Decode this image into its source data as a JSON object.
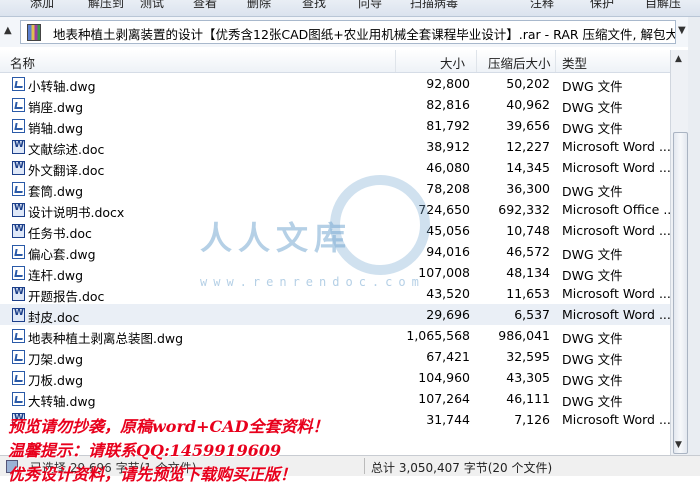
{
  "toolbar": {
    "buttons": [
      "添加",
      "解压到",
      "测试",
      "查看",
      "删除",
      "查找",
      "向导",
      "扫描病毒",
      "注释",
      "保护",
      "自解压"
    ]
  },
  "pathbar": {
    "path": "地表种植土剥离装置的设计【优秀含12张CAD图纸+农业用机械全套课程毕业设计】.rar - RAR 压缩文件, 解包大小为"
  },
  "columns": {
    "name": "名称",
    "size": "大小",
    "packed": "压缩后大小",
    "type": "类型"
  },
  "files": [
    {
      "name": "小转轴.dwg",
      "size": "92,800",
      "packed": "50,202",
      "type": "DWG 文件",
      "kind": "dwg"
    },
    {
      "name": "销座.dwg",
      "size": "82,816",
      "packed": "40,962",
      "type": "DWG 文件",
      "kind": "dwg"
    },
    {
      "name": "销轴.dwg",
      "size": "81,792",
      "packed": "39,656",
      "type": "DWG 文件",
      "kind": "dwg"
    },
    {
      "name": "文献综述.doc",
      "size": "38,912",
      "packed": "12,227",
      "type": "Microsoft Word ...",
      "kind": "doc"
    },
    {
      "name": "外文翻译.doc",
      "size": "46,080",
      "packed": "14,345",
      "type": "Microsoft Word ...",
      "kind": "doc"
    },
    {
      "name": "套筒.dwg",
      "size": "78,208",
      "packed": "36,300",
      "type": "DWG 文件",
      "kind": "dwg"
    },
    {
      "name": "设计说明书.docx",
      "size": "724,650",
      "packed": "692,332",
      "type": "Microsoft Office ...",
      "kind": "doc"
    },
    {
      "name": "任务书.doc",
      "size": "45,056",
      "packed": "10,748",
      "type": "Microsoft Word ...",
      "kind": "doc"
    },
    {
      "name": "偏心套.dwg",
      "size": "94,016",
      "packed": "46,572",
      "type": "DWG 文件",
      "kind": "dwg"
    },
    {
      "name": "连杆.dwg",
      "size": "107,008",
      "packed": "48,134",
      "type": "DWG 文件",
      "kind": "dwg"
    },
    {
      "name": "开题报告.doc",
      "size": "43,520",
      "packed": "11,653",
      "type": "Microsoft Word ...",
      "kind": "doc"
    },
    {
      "name": "封皮.doc",
      "size": "29,696",
      "packed": "6,537",
      "type": "Microsoft Word ...",
      "kind": "doc",
      "selected": true
    },
    {
      "name": "地表种植土剥离总装图.dwg",
      "size": "1,065,568",
      "packed": "986,041",
      "type": "DWG 文件",
      "kind": "dwg"
    },
    {
      "name": "刀架.dwg",
      "size": "67,421",
      "packed": "32,595",
      "type": "DWG 文件",
      "kind": "dwg"
    },
    {
      "name": "刀板.dwg",
      "size": "104,960",
      "packed": "43,305",
      "type": "DWG 文件",
      "kind": "dwg"
    },
    {
      "name": "大转轴.dwg",
      "size": "107,264",
      "packed": "46,111",
      "type": "DWG 文件",
      "kind": "dwg"
    },
    {
      "name": "",
      "size": "31,744",
      "packed": "7,126",
      "type": "Microsoft Word ...",
      "kind": "doc"
    }
  ],
  "status": {
    "left": "已选择 29,696 字节(1 个文件)",
    "right": "总计 3,050,407 字节(20 个文件)"
  },
  "watermark": {
    "chars": "人人文库",
    "url": "www.renrendoc.com"
  },
  "overlay": {
    "line1": "预览请勿抄袭，原稿word+CAD全套资料！",
    "line2": "温馨提示：请联系QQ:1459919609",
    "line3": "优秀设计资料，请先预览下载购买正版！"
  },
  "colors": {
    "overlay_red": "#e8001c",
    "selected_row": "#eaeff6",
    "watermark_blue": "#78aad2"
  }
}
